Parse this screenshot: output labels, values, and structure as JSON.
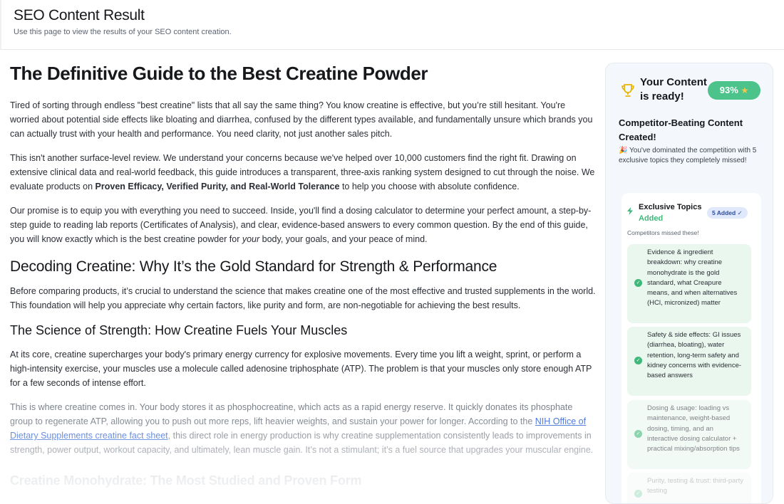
{
  "header": {
    "title": "SEO Content Result",
    "subtitle": "Use this page to view the results of your SEO content creation."
  },
  "article": {
    "title": "The Definitive Guide to the Best Creatine Powder",
    "intro_p1": "Tired of sorting through endless \"best creatine\" lists that all say the same thing? You know creatine is effective, but you’re still hesitant. You're worried about potential side effects like bloating and diarrhea, confused by the different types available, and fundamentally unsure which brands you can actually trust with your health and performance. You need clarity, not just another sales pitch.",
    "intro_p2_a": "This isn't another surface-level review. We understand your concerns because we've helped over 10,000 customers find the right fit. Drawing on extensive clinical data and real-world feedback, this guide introduces a transparent, three-axis ranking system designed to cut through the noise. We evaluate products on ",
    "intro_p2_bold": "Proven Efficacy, Verified Purity, and Real-World Tolerance",
    "intro_p2_b": " to help you choose with absolute confidence.",
    "intro_p3_a": "Our promise is to equip you with everything you need to succeed. Inside, you'll find a dosing calculator to determine your perfect amount, a step-by-step guide to reading lab reports (Certificates of Analysis), and clear, evidence-based answers to every common question. By the end of this guide, you will know exactly which is the best creatine powder for ",
    "intro_p3_em": "your",
    "intro_p3_b": " body, your goals, and your peace of mind.",
    "h2_decoding": "Decoding Creatine: Why It’s the Gold Standard for Strength & Performance",
    "decoding_p": "Before comparing products, it’s crucial to understand the science that makes creatine one of the most effective and trusted supplements in the world. This foundation will help you appreciate why certain factors, like purity and form, are non-negotiable for achieving the best results.",
    "h3_science": "The Science of Strength: How Creatine Fuels Your Muscles",
    "science_p1": "At its core, creatine supercharges your body's primary energy currency for explosive movements. Every time you lift a weight, sprint, or perform a high-intensity exercise, your muscles use a molecule called adenosine triphosphate (ATP). The problem is that your muscles only store enough ATP for a few seconds of intense effort.",
    "science_p2_a": "This is where creatine comes in. Your body stores it as phosphocreatine, which acts as a rapid energy reserve. It quickly donates its phosphate group to regenerate ATP, allowing you to push out more reps, lift heavier weights, and sustain your power for longer. According to the ",
    "science_p2_link": "NIH Office of Dietary Supplements creatine fact sheet",
    "science_p2_b": ", this direct role in energy production is why creatine supplementation consistently leads to improvements in strength, power output, workout capacity, and ultimately, lean muscle gain. It’s not a stimulant; it’s a fuel source that upgrades your muscular engine.",
    "h2_monohydrate": "Creatine Monohydrate: The Most Studied and Proven Form"
  },
  "sidebar": {
    "icon": "trophy-icon",
    "ready_title": "Your Content is ready!",
    "score": "93%",
    "score_value": 93,
    "star": "★",
    "competitor_title": "Competitor-Beating Content Created!",
    "competitor_desc": "🎉 You've dominated the competition with 5 exclusive topics they completely missed!",
    "topics": {
      "title_a": "Exclusive Topics ",
      "title_b": "Added",
      "badge": "5 Added ✓",
      "missed": "Competitors missed these!",
      "items": [
        "Evidence & ingredient breakdown: why creatine monohydrate is the gold standard, what Creapure means, and when alternatives (HCl, micronized) matter",
        "Safety & side effects: GI issues (diarrhea, bloating), water retention, long-term safety and kidney concerns with evidence-based answers",
        "Dosing & usage: loading vs maintenance, weight-based dosing, timing, and an interactive dosing calculator + practical mixing/absorption tips",
        "Purity, testing & trust: third-party testing"
      ]
    },
    "colors": {
      "accent_green": "#4cc38a",
      "badge_blue": "#dfe9fb",
      "trophy": "#e8b400"
    }
  }
}
